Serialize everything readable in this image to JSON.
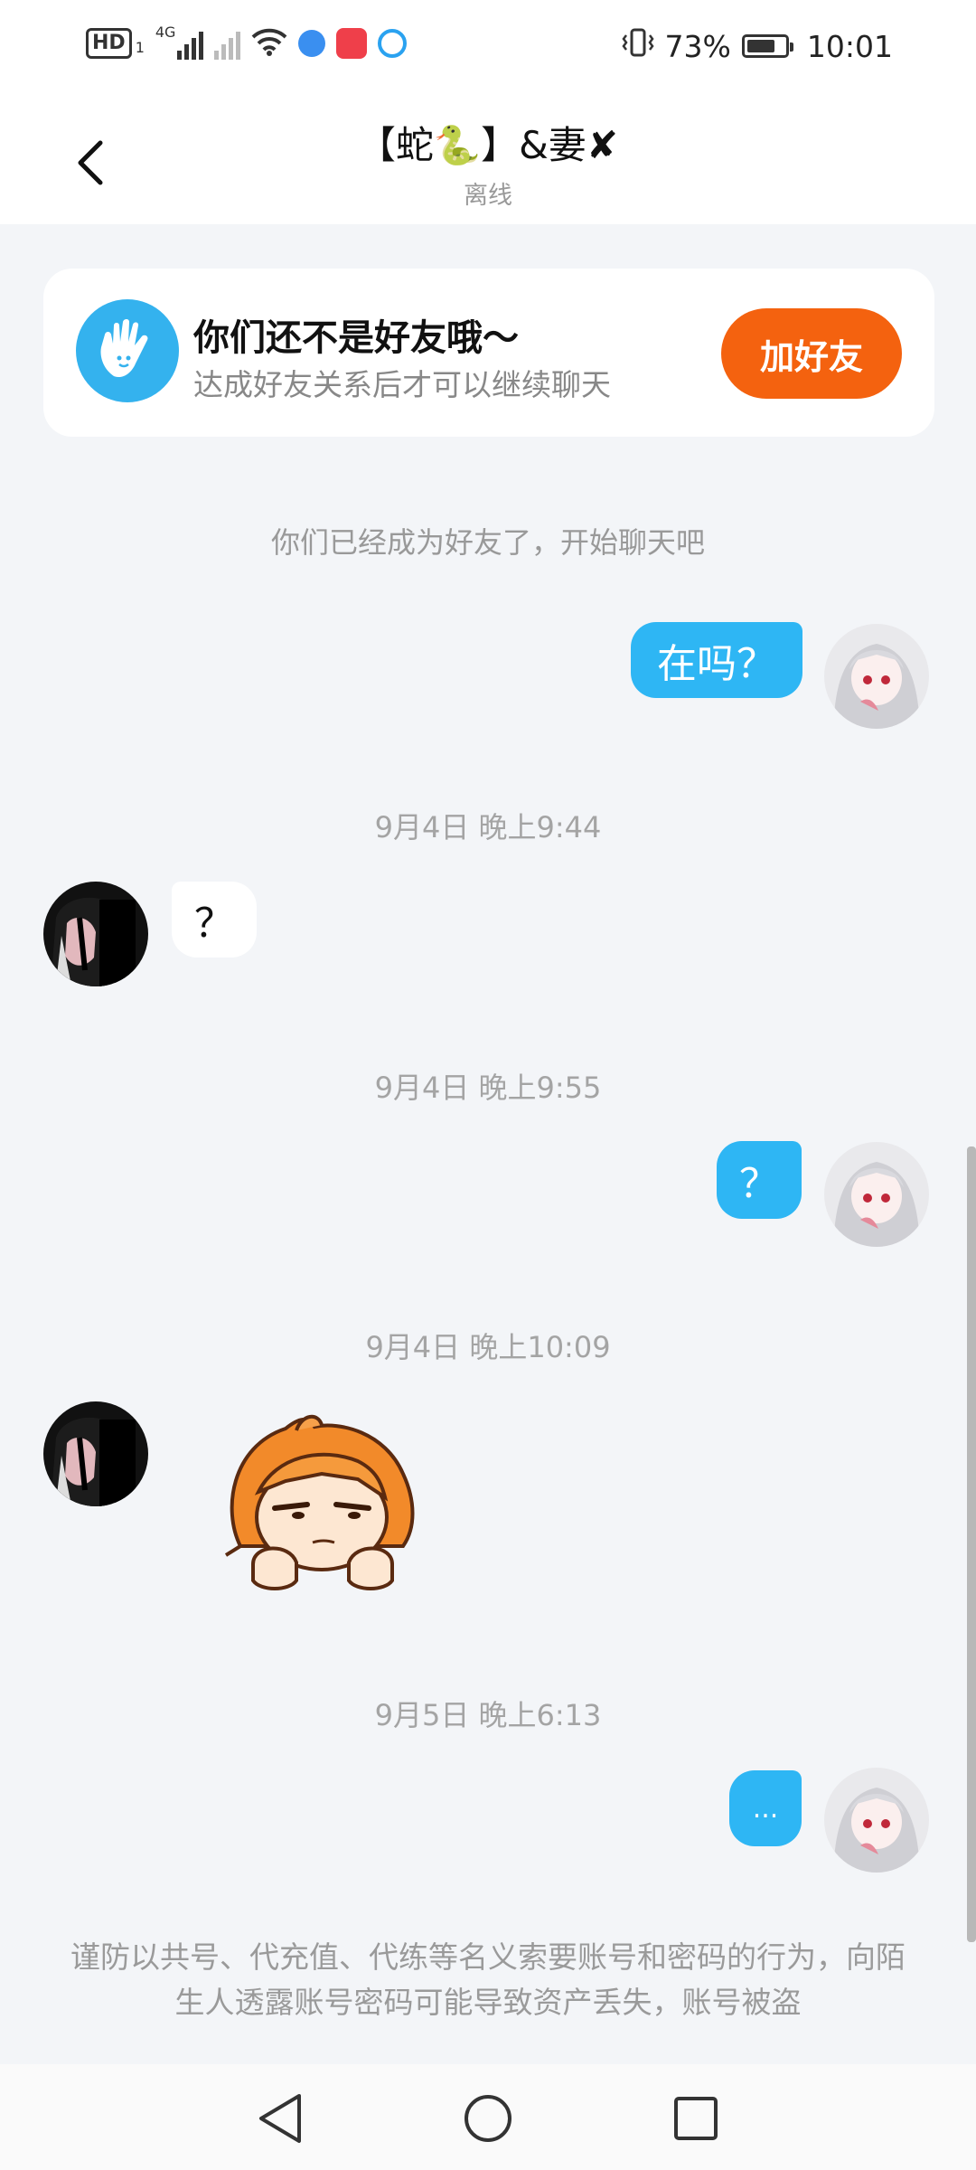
{
  "status_bar": {
    "hd": "HD",
    "sim": "1",
    "net": "4G",
    "battery_text": "73%",
    "battery_level": 0.73,
    "time": "10:01"
  },
  "header": {
    "title": "【蛇🐍】&妻✘",
    "status": "离线"
  },
  "friend_card": {
    "title": "你们还不是好友哦～",
    "description": "达成好友关系后才可以继续聊天",
    "button": "加好友"
  },
  "system_message": "你们已经成为好友了，开始聊天吧",
  "messages": [
    {
      "timestamp": "",
      "side": "out",
      "text": "在吗？"
    },
    {
      "timestamp": "9月4日 晚上9:44",
      "side": "in",
      "text": "？"
    },
    {
      "timestamp": "9月4日 晚上9:55",
      "side": "out",
      "text": "？"
    },
    {
      "timestamp": "9月4日 晚上10:09",
      "side": "in",
      "text": "",
      "sticker": "orange-hair-girl-sticker"
    },
    {
      "timestamp": "9月5日 晚上6:13",
      "side": "out",
      "text": "..."
    }
  ],
  "warning": "谨防以共号、代充值、代练等名义索要账号和密码的行为，向陌生人透露账号密码可能导致资产丢失，账号被盗",
  "colors": {
    "accent_blue": "#2eb6f4",
    "add_button": "#f4620f",
    "background": "#f3f5f8"
  }
}
